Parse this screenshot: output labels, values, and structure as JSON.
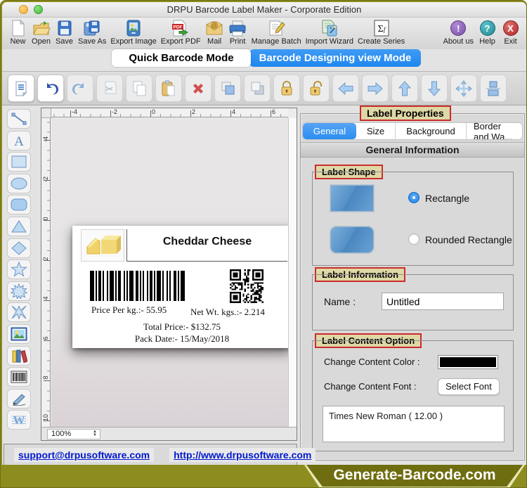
{
  "window": {
    "title": "DRPU Barcode Label Maker - Corporate Edition"
  },
  "toolbar": {
    "items": [
      "New",
      "Open",
      "Save",
      "Save As",
      "Export Image",
      "Export PDF",
      "Mail",
      "Print",
      "Manage Batch",
      "Import Wizard",
      "Create Series",
      "About us",
      "Help",
      "Exit"
    ],
    "sigma_glyph": "Σf"
  },
  "mode_tabs": {
    "quick": "Quick Barcode Mode",
    "designing": "Barcode Designing view Mode",
    "active": "designing"
  },
  "edit_toolbar": {
    "items": [
      "properties-note",
      "undo",
      "redo",
      "cut",
      "copy",
      "paste",
      "delete",
      "bring-to-front",
      "send-to-back",
      "lock",
      "unlock",
      "move-left",
      "move-right",
      "move-up",
      "move-down",
      "center-object",
      "align-middle"
    ]
  },
  "tools": {
    "items": [
      "line",
      "text",
      "rectangle",
      "ellipse",
      "rounded-rectangle",
      "triangle",
      "diamond",
      "star",
      "starburst",
      "four-point-star",
      "image",
      "library",
      "barcode",
      "pen",
      "watermark"
    ]
  },
  "canvas": {
    "zoom_level": "100%",
    "h_ruler": [
      "-4",
      "-2",
      "0",
      "2",
      "4",
      "6"
    ],
    "v_ruler": [
      "-4",
      "-2",
      "0",
      "2",
      "4",
      "6",
      "8",
      "10"
    ],
    "label": {
      "title": "Cheddar Cheese",
      "price_per_kg": "Price Per kg.:-  55.95",
      "net_wt": "Net Wt. kgs.:- 2.214",
      "total_price": "Total Price:- $132.75",
      "pack_date": "Pack Date:- 15/May/2018",
      "barcode_pattern": [
        3,
        1,
        1,
        1,
        2,
        1,
        1,
        2,
        1,
        1,
        3,
        1,
        1,
        1,
        2,
        2,
        1,
        1,
        1,
        1,
        3,
        1,
        2,
        1,
        1,
        1,
        1,
        2,
        1,
        1,
        2,
        1,
        1,
        1,
        3,
        1,
        1,
        2,
        1,
        1,
        1,
        2,
        2,
        1,
        1,
        1,
        3,
        1
      ],
      "qr": {
        "size": 21,
        "seed": 11
      }
    }
  },
  "properties": {
    "title": "Label Properties",
    "tabs": [
      "General",
      "Size",
      "Background",
      "Border and Wa..."
    ],
    "active_tab": "General",
    "section_header": "General Information",
    "label_shape": {
      "title": "Label Shape",
      "options": [
        {
          "label": "Rectangle",
          "selected": true
        },
        {
          "label": "Rounded Rectangle",
          "selected": false
        }
      ]
    },
    "label_information": {
      "title": "Label Information",
      "name_label": "Name :",
      "name_value": "Untitled"
    },
    "label_content": {
      "title": "Label Content Option",
      "color_label": "Change Content Color :",
      "color_value": "#000000",
      "font_label": "Change Content Font :",
      "font_button": "Select Font",
      "font_preview": "Times New Roman ( 12.00 )"
    }
  },
  "footer": {
    "email": "support@drpusoftware.com",
    "website": "http://www.drpusoftware.com",
    "badge": "Generate-Barcode.com"
  },
  "colors": {
    "accent_blue": "#2b8df0",
    "frame_olive": "#8d8d1f",
    "badge_bg": "#ded8a6",
    "badge_border": "#cc2b2b"
  }
}
